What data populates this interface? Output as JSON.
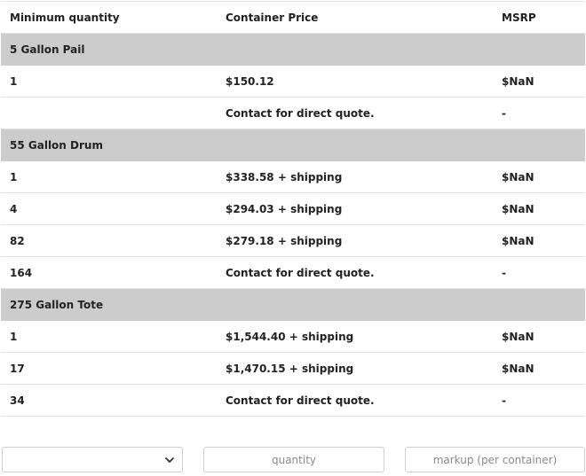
{
  "table": {
    "headers": {
      "quantity": "Minimum quantity",
      "price": "Container Price",
      "msrp": "MSRP"
    },
    "groups": [
      {
        "name": "5 Gallon Pail",
        "rows": [
          {
            "qty": "1",
            "price": "$150.12",
            "msrp": "$NaN"
          },
          {
            "qty": "",
            "price": "Contact for direct quote.",
            "msrp": "-"
          }
        ]
      },
      {
        "name": "55 Gallon Drum",
        "rows": [
          {
            "qty": "1",
            "price": "$338.58 + shipping",
            "msrp": "$NaN"
          },
          {
            "qty": "4",
            "price": "$294.03 + shipping",
            "msrp": "$NaN"
          },
          {
            "qty": "82",
            "price": "$279.18 + shipping",
            "msrp": "$NaN"
          },
          {
            "qty": "164",
            "price": "Contact for direct quote.",
            "msrp": "-"
          }
        ]
      },
      {
        "name": "275 Gallon Tote",
        "rows": [
          {
            "qty": "1",
            "price": "$1,544.40 + shipping",
            "msrp": "$NaN"
          },
          {
            "qty": "17",
            "price": "$1,470.15 + shipping",
            "msrp": "$NaN"
          },
          {
            "qty": "34",
            "price": "Contact for direct quote.",
            "msrp": "-"
          }
        ]
      }
    ]
  },
  "controls": {
    "container_select": {
      "selected": "",
      "icon": "chevron-down-icon"
    },
    "quantity_placeholder": "quantity",
    "markup_placeholder": "markup (per container)"
  }
}
